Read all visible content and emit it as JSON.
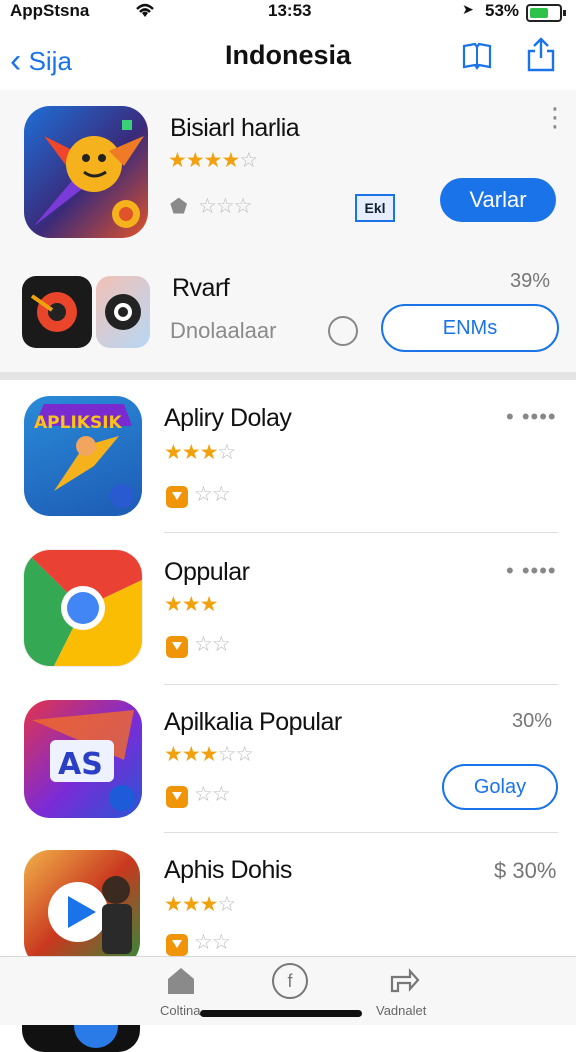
{
  "status": {
    "carrier": "AppStsna",
    "time": "13:53",
    "battery": "53%"
  },
  "nav": {
    "back_label": "Sija",
    "title": "Indonesia"
  },
  "featured": [
    {
      "name": "Bisiarl harlia",
      "rating_filled": 4,
      "sub_label": "Varlar",
      "button": "Varlar",
      "meta_tag": "Ekl"
    },
    {
      "name": "Rvarf",
      "subtitle": "Dnolaalaar",
      "percent": "39%",
      "button": "ENMs"
    }
  ],
  "list": [
    {
      "name": "Apliry Dolay",
      "rating_filled": 3,
      "more": "• ••••",
      "icon_text": "APLIKSIK"
    },
    {
      "name": "Oppular",
      "rating_filled": 3,
      "more": "• ••••"
    },
    {
      "name": "Apilkalia Popular",
      "rating_filled": 3,
      "percent": "30%",
      "button": "Golay",
      "icon_text": "AS"
    },
    {
      "name": "Aphis Dohis",
      "rating_filled": 3,
      "percent": "$ 30%"
    }
  ],
  "tabs": [
    {
      "label": "Coltina",
      "icon": "house-icon"
    },
    {
      "label": "",
      "icon": "compass-icon"
    },
    {
      "label": "Vadnalet",
      "icon": "share-arrow-icon"
    }
  ],
  "colors": {
    "accent": "#1a73e8",
    "star": "#f2a10e",
    "badge": "#f0940a"
  }
}
